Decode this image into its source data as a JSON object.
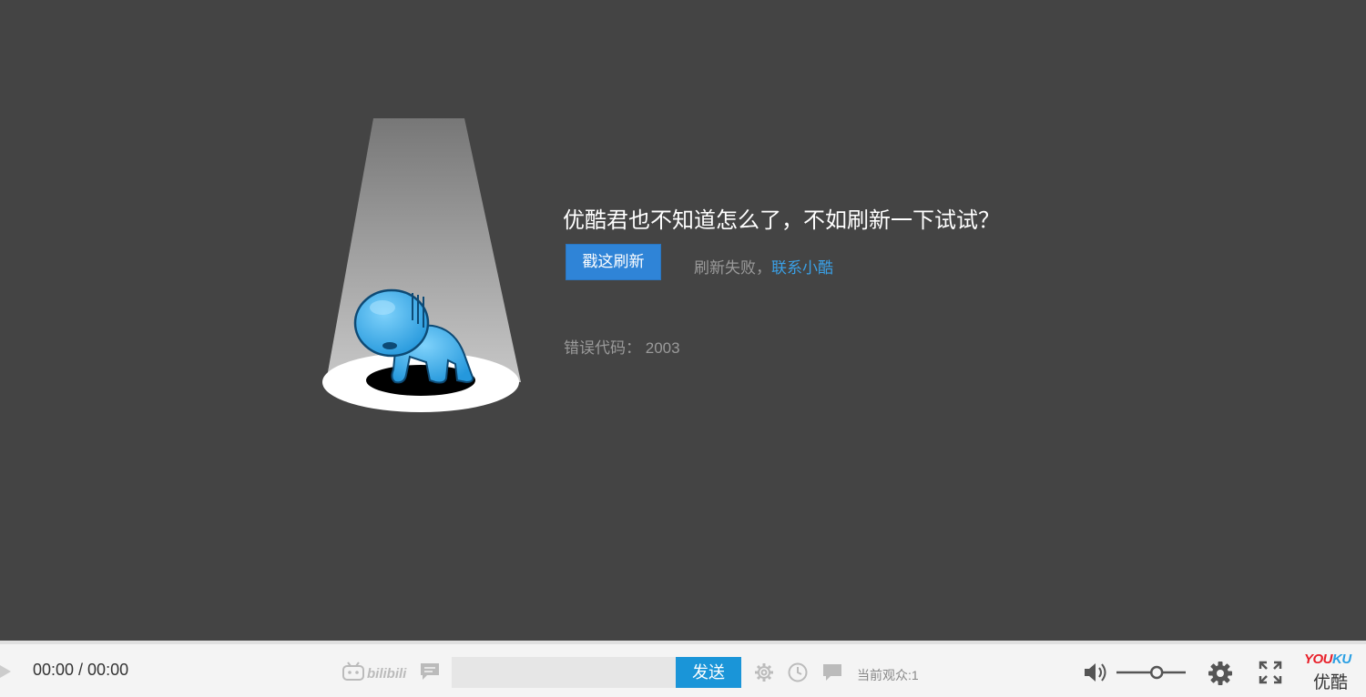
{
  "error": {
    "title": "优酷君也不知道怎么了，不如刷新一下试试？",
    "refresh_button": "戳这刷新",
    "refresh_failed_prefix": "刷新失败，",
    "contact_link": "联系小酷",
    "error_code_label": "错误代码：",
    "error_code": "2003"
  },
  "player": {
    "time": "00:00 / 00:00",
    "danmaku_brand": "bilibili",
    "danmaku_input_placeholder": "",
    "send_button": "发送",
    "viewers": "当前观众:1",
    "volume": 0.6
  },
  "logo": {
    "en_part1": "YOU",
    "en_part2": "KU",
    "cn": "优酷"
  },
  "colors": {
    "background": "#444444",
    "accent_blue": "#2f84d7",
    "link_blue": "#3aa0e6",
    "send_blue": "#1a95d8",
    "logo_red": "#e8202a",
    "mascot_blue": "#3ab0ee"
  }
}
